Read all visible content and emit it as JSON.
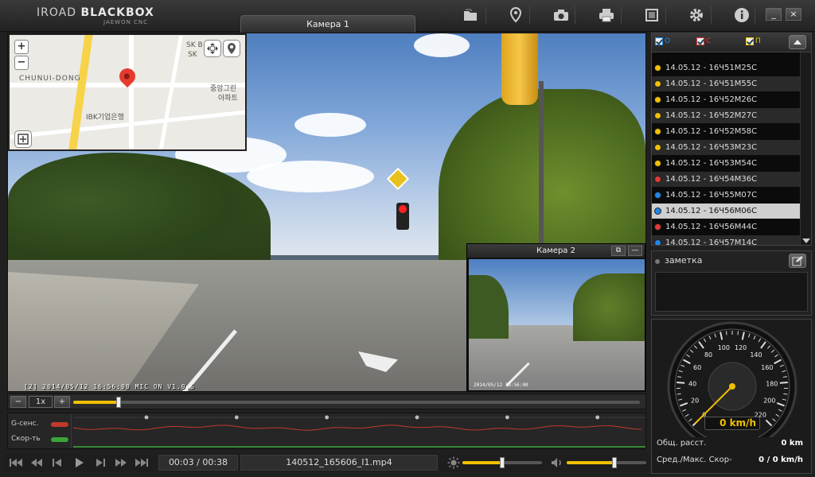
{
  "app": {
    "logo_text_a": "IROAD ",
    "logo_text_b": "BLACKBOX",
    "logo_sub": "JAEWON CNC"
  },
  "toolbar": {
    "camera1_tab": "Камера 1",
    "icons": [
      "folder-icon",
      "map-pin-icon",
      "camera-icon",
      "print-icon",
      "fullscreen-icon",
      "settings-icon",
      "info-icon"
    ],
    "minimize_label": "_",
    "close_label": "×"
  },
  "map": {
    "label_district": "CHUNUI-DONG",
    "label_sk": "SK B",
    "label_sk2": "SK",
    "label_ibk": "IBK기업은행",
    "label_apt1": "중앙그린",
    "label_apt2": "아파트",
    "zoom_in": "+",
    "zoom_out": "−"
  },
  "main_video": {
    "osd_text": "[2] 2014/05/12 16:56:00     MIC ON  V1.0.5"
  },
  "camera2": {
    "title": "Камера 2",
    "restore_label": "⧉",
    "minimize_label": "—",
    "osd_text": "2014/05/12  16:56:00"
  },
  "seek": {
    "speed_label": "1x",
    "minus_label": "−",
    "plus_label": "+",
    "progress": 0.08
  },
  "graph": {
    "gsensor_label": "G-сенс.",
    "speed_label": "Скор-ть",
    "gsensor_color": "#c0392b",
    "speed_color": "#3aa33a",
    "marker_count": 7
  },
  "controls": {
    "time": "00:03 / 00:38",
    "file": "140512_165606_I1.mp4",
    "brightness_level": 0.5,
    "volume_level": 0.6,
    "icons": [
      "skip-start-icon",
      "rewind-fast-icon",
      "step-back-icon",
      "play-icon",
      "step-forward-icon",
      "forward-fast-icon",
      "skip-end-icon"
    ]
  },
  "filelist": {
    "filter_o": "O",
    "filter_c": "C",
    "filter_p": "П",
    "filter_o_color": "#1e88e5",
    "filter_c_color": "#e53935",
    "filter_p_color": "#f0c000",
    "items": [
      {
        "label": "14.05.12 - 16Ч51M25C",
        "color": "#f0c000",
        "state": "normal"
      },
      {
        "label": "14.05.12 - 16Ч51M55C",
        "color": "#f0c000",
        "state": "alt"
      },
      {
        "label": "14.05.12 - 16Ч52M26C",
        "color": "#f0c000",
        "state": "normal"
      },
      {
        "label": "14.05.12 - 16Ч52M27C",
        "color": "#f0c000",
        "state": "alt"
      },
      {
        "label": "14.05.12 - 16Ч52M58C",
        "color": "#f0c000",
        "state": "normal"
      },
      {
        "label": "14.05.12 - 16Ч53M23C",
        "color": "#f0c000",
        "state": "alt"
      },
      {
        "label": "14.05.12 - 16Ч53M54C",
        "color": "#f0c000",
        "state": "normal"
      },
      {
        "label": "14.05.12 - 16Ч54M36C",
        "color": "#e53935",
        "state": "alt"
      },
      {
        "label": "14.05.12 - 16Ч55M07C",
        "color": "#1e88e5",
        "state": "normal"
      },
      {
        "label": "14.05.12 - 16Ч56M06C",
        "color": "#1e88e5",
        "state": "selected"
      },
      {
        "label": "14.05.12 - 16Ч56M44C",
        "color": "#e53935",
        "state": "normal"
      },
      {
        "label": "14.05.12 - 16Ч57M14C",
        "color": "#1e88e5",
        "state": "alt"
      }
    ]
  },
  "note": {
    "title": "заметка"
  },
  "speedometer": {
    "ticks": [
      "0",
      "20",
      "40",
      "60",
      "80",
      "100",
      "120",
      "140",
      "160",
      "180",
      "200",
      "220"
    ],
    "readout": "0 km/h",
    "total_label": "Общ. расст.",
    "total_value": "0 km",
    "avgmax_label": "Сред./Макс. Скор-",
    "avgmax_value": "0 / 0 km/h",
    "current_speed": 0
  }
}
